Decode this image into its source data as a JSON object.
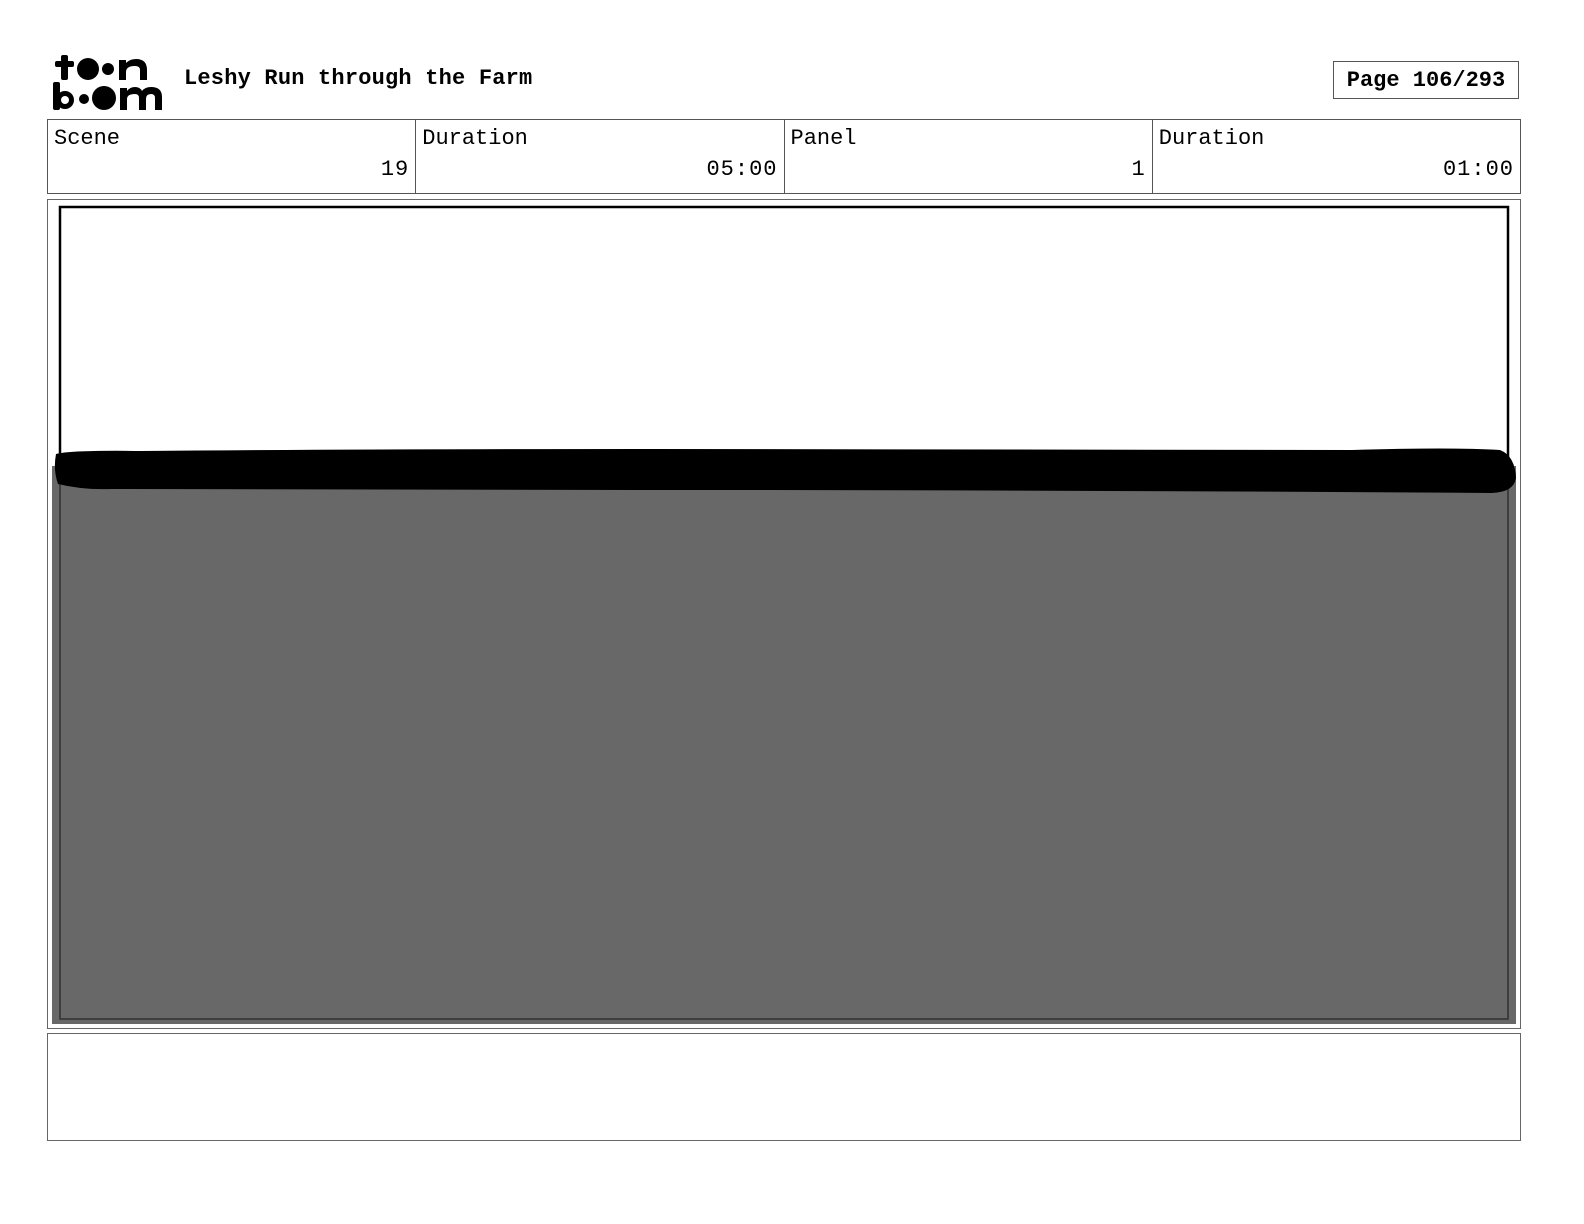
{
  "logo": {
    "line1": "to●n",
    "line2": "b●●m",
    "icon": "toon-boom-logo"
  },
  "header": {
    "project_title": "Leshy Run through the Farm",
    "page_label": "Page 106/293"
  },
  "info": {
    "scene_label": "Scene",
    "scene_value": "19",
    "scene_duration_label": "Duration",
    "scene_duration_value": "05:00",
    "panel_label": "Panel",
    "panel_value": "1",
    "panel_duration_label": "Duration",
    "panel_duration_value": "01:00"
  },
  "colors": {
    "ground": "#686868",
    "horizon_stroke": "#000000",
    "sky": "#ffffff"
  },
  "notes": {
    "text": ""
  }
}
